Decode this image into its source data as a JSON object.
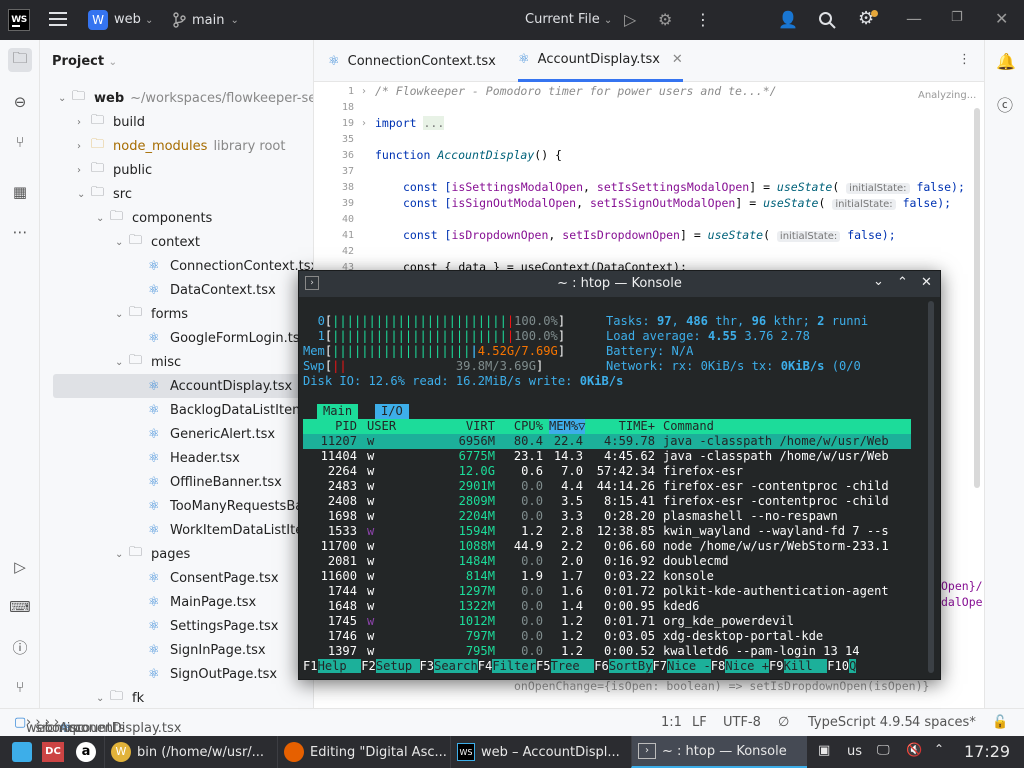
{
  "topbar": {
    "project_initial": "W",
    "project_name": "web",
    "branch": "main",
    "run_config": "Current File"
  },
  "project_panel": {
    "title": "Project",
    "rows": [
      {
        "label": "web",
        "hint": "~/workspaces/flowkeeper-server/"
      },
      {
        "label": "build",
        "hint": ""
      },
      {
        "label": "node_modules",
        "hint": "library root"
      },
      {
        "label": "public",
        "hint": ""
      },
      {
        "label": "src",
        "hint": ""
      },
      {
        "label": "components",
        "hint": ""
      },
      {
        "label": "context",
        "hint": ""
      },
      {
        "label": "ConnectionContext.tsx",
        "hint": ""
      },
      {
        "label": "DataContext.tsx",
        "hint": ""
      },
      {
        "label": "forms",
        "hint": ""
      },
      {
        "label": "GoogleFormLogin.tsx",
        "hint": ""
      },
      {
        "label": "misc",
        "hint": ""
      },
      {
        "label": "AccountDisplay.tsx",
        "hint": ""
      },
      {
        "label": "BacklogDataListItem.tsx",
        "hint": ""
      },
      {
        "label": "GenericAlert.tsx",
        "hint": ""
      },
      {
        "label": "Header.tsx",
        "hint": ""
      },
      {
        "label": "OfflineBanner.tsx",
        "hint": ""
      },
      {
        "label": "TooManyRequestsBanner.tsx",
        "hint": ""
      },
      {
        "label": "WorkItemDataListItem.tsx",
        "hint": ""
      },
      {
        "label": "pages",
        "hint": ""
      },
      {
        "label": "ConsentPage.tsx",
        "hint": ""
      },
      {
        "label": "MainPage.tsx",
        "hint": ""
      },
      {
        "label": "SettingsPage.tsx",
        "hint": ""
      },
      {
        "label": "SignInPage.tsx",
        "hint": ""
      },
      {
        "label": "SignOutPage.tsx",
        "hint": ""
      },
      {
        "label": "fk",
        "hint": ""
      }
    ]
  },
  "editor": {
    "tabs": [
      {
        "label": "ConnectionContext.tsx"
      },
      {
        "label": "AccountDisplay.tsx"
      }
    ],
    "status_hint": "Analyzing...",
    "line_numbers": [
      "1",
      "18",
      "19",
      "35",
      "36",
      "37",
      "38",
      "39",
      "40",
      "41",
      "42",
      "43"
    ],
    "code": {
      "l1": "/* Flowkeeper - Pomodoro timer for power users and te...*/",
      "l19_kw": "import",
      "l19_rest": "...",
      "l36_kw": "function",
      "l36_fn": "AccountDisplay",
      "l36_rest": "() {",
      "l38_a": "const [",
      "l38_v1": "isSettingsModalOpen",
      "l38_b": ", ",
      "l38_v2": "setIsSettingsModalOpen",
      "l38_c": "] = ",
      "l38_fn": "useState",
      "l38_d": "( ",
      "l38_hint": "initialState:",
      "l38_e": " false);",
      "l39_a": "const [",
      "l39_v1": "isSignOutModalOpen",
      "l39_b": ", ",
      "l39_v2": "setIsSignOutModalOpen",
      "l39_c": "] = ",
      "l39_fn": "useState",
      "l39_d": "( ",
      "l39_hint": "initialState:",
      "l39_e": " false);",
      "l41_a": "const [",
      "l41_v1": "isDropdownOpen",
      "l41_b": ", ",
      "l41_v2": "setIsDropdownOpen",
      "l41_c": "] = ",
      "l41_fn": "useState",
      "l41_d": "( ",
      "l41_hint": "initialState:",
      "l41_e": " false);",
      "l43": "const { data } = useContext(DataContext);",
      "side1": "Open}/",
      "side2": "dalOpe",
      "bottom": "onOpenChange={isOpen: boolean) => setIsDropdownOpen(isOpen)}"
    }
  },
  "status": {
    "crumbs": [
      "web",
      "src",
      "components",
      "misc",
      "AccountDisplay.tsx"
    ],
    "position": "1:1",
    "line_sep": "LF",
    "encoding": "UTF-8",
    "language": "TypeScript 4.9.5",
    "indent": "4 spaces*"
  },
  "konsole": {
    "title": "~ : htop — Konsole",
    "cpu0_label": "0",
    "cpu0_pct": "100.0%",
    "cpu1_label": "1",
    "cpu1_pct": "100.0%",
    "mem_label": "Mem",
    "mem_val": "4.52G/7.69G",
    "swp_label": "Swp",
    "swp_val": "39.8M/3.69G",
    "tasks": "Tasks: ",
    "tasks_n": "97",
    "tasks_b": ", ",
    "thr_n": "486",
    "thr_l": " thr, ",
    "kthr_n": "96",
    "kthr_l": " kthr; ",
    "run_n": "2",
    "run_l": " runni",
    "load_l": "Load average: ",
    "load1": "4.55",
    "load5": "3.76",
    "load15": "2.78",
    "battery": "Battery: N/A",
    "net_l": "Network: rx: ",
    "net_rx": "0KiB/s",
    "net_tx_l": " tx: ",
    "net_tx": "0KiB/s",
    "net_tail": " (0/0",
    "disk_l": "Disk IO: 12.6% read: 16.2MiB/s write: ",
    "disk_w": "0KiB/s",
    "tab_main": "Main",
    "tab_io": "I/O",
    "cols": {
      "pid": "PID",
      "user": "USER",
      "virt": "VIRT",
      "cpu": "CPU%",
      "mem": "MEM%▽",
      "time": "TIME+",
      "cmd": "Command"
    },
    "procs": [
      {
        "pid": "11207",
        "user": "w",
        "virt": "6956M",
        "cpu": "80.4",
        "mem": "22.4",
        "time": "4:59.78",
        "cmd": "java -classpath /home/w/usr/Web"
      },
      {
        "pid": "11404",
        "user": "w",
        "virt": "6775M",
        "cpu": "23.1",
        "mem": "14.3",
        "time": "4:45.62",
        "cmd": "java -classpath /home/w/usr/Web"
      },
      {
        "pid": "2264",
        "user": "w",
        "virt": "12.0G",
        "cpu": "0.6",
        "mem": "7.0",
        "time": "57:42.34",
        "cmd": "firefox-esr"
      },
      {
        "pid": "2483",
        "user": "w",
        "virt": "2901M",
        "cpu": "0.0",
        "mem": "4.4",
        "time": "44:14.26",
        "cmd": "firefox-esr -contentproc -child"
      },
      {
        "pid": "2408",
        "user": "w",
        "virt": "2809M",
        "cpu": "0.0",
        "mem": "3.5",
        "time": "8:15.41",
        "cmd": "firefox-esr -contentproc -child"
      },
      {
        "pid": "1698",
        "user": "w",
        "virt": "2204M",
        "cpu": "0.0",
        "mem": "3.3",
        "time": "0:28.20",
        "cmd": "plasmashell --no-respawn"
      },
      {
        "pid": "1533",
        "user": "w",
        "virt": "1594M",
        "cpu": "1.2",
        "mem": "2.8",
        "time": "12:38.85",
        "cmd": "kwin_wayland --wayland-fd 7 --s"
      },
      {
        "pid": "11700",
        "user": "w",
        "virt": "1088M",
        "cpu": "44.9",
        "mem": "2.2",
        "time": "0:06.60",
        "cmd": "node /home/w/usr/WebStorm-233.1"
      },
      {
        "pid": "2081",
        "user": "w",
        "virt": "1484M",
        "cpu": "0.0",
        "mem": "2.0",
        "time": "0:16.92",
        "cmd": "doublecmd"
      },
      {
        "pid": "11600",
        "user": "w",
        "virt": "814M",
        "cpu": "1.9",
        "mem": "1.7",
        "time": "0:03.22",
        "cmd": "konsole"
      },
      {
        "pid": "1744",
        "user": "w",
        "virt": "1297M",
        "cpu": "0.0",
        "mem": "1.6",
        "time": "0:01.72",
        "cmd": "polkit-kde-authentication-agent"
      },
      {
        "pid": "1648",
        "user": "w",
        "virt": "1322M",
        "cpu": "0.0",
        "mem": "1.4",
        "time": "0:00.95",
        "cmd": "kded6"
      },
      {
        "pid": "1745",
        "user": "w",
        "virt": "1012M",
        "cpu": "0.0",
        "mem": "1.2",
        "time": "0:01.71",
        "cmd": "org_kde_powerdevil"
      },
      {
        "pid": "1746",
        "user": "w",
        "virt": "797M",
        "cpu": "0.0",
        "mem": "1.2",
        "time": "0:03.05",
        "cmd": "xdg-desktop-portal-kde"
      },
      {
        "pid": "1397",
        "user": "w",
        "virt": "795M",
        "cpu": "0.0",
        "mem": "1.2",
        "time": "0:00.52",
        "cmd": "kwalletd6 --pam-login 13 14"
      }
    ],
    "fkeys": [
      {
        "k": "F1",
        "l": "Help  "
      },
      {
        "k": "F2",
        "l": "Setup "
      },
      {
        "k": "F3",
        "l": "Search"
      },
      {
        "k": "F4",
        "l": "Filter"
      },
      {
        "k": "F5",
        "l": "Tree  "
      },
      {
        "k": "F6",
        "l": "SortBy"
      },
      {
        "k": "F7",
        "l": "Nice -"
      },
      {
        "k": "F8",
        "l": "Nice +"
      },
      {
        "k": "F9",
        "l": "Kill  "
      },
      {
        "k": "F10",
        "l": "Q"
      }
    ]
  },
  "taskbar": {
    "tasks": [
      "bin (/home/w/usr/...",
      "Editing \"Digital Asc...",
      "web – AccountDispl...",
      "~ : htop — Konsole"
    ],
    "kbd_layout": "us",
    "clock": "17:29"
  },
  "colors": {
    "ide_dark": "#27282c",
    "accent": "#3574f0",
    "htop_green": "#1cdc9a",
    "htop_cyan": "#3daee9",
    "htop_red": "#ed1515",
    "taskbar": "#2b2c30"
  }
}
